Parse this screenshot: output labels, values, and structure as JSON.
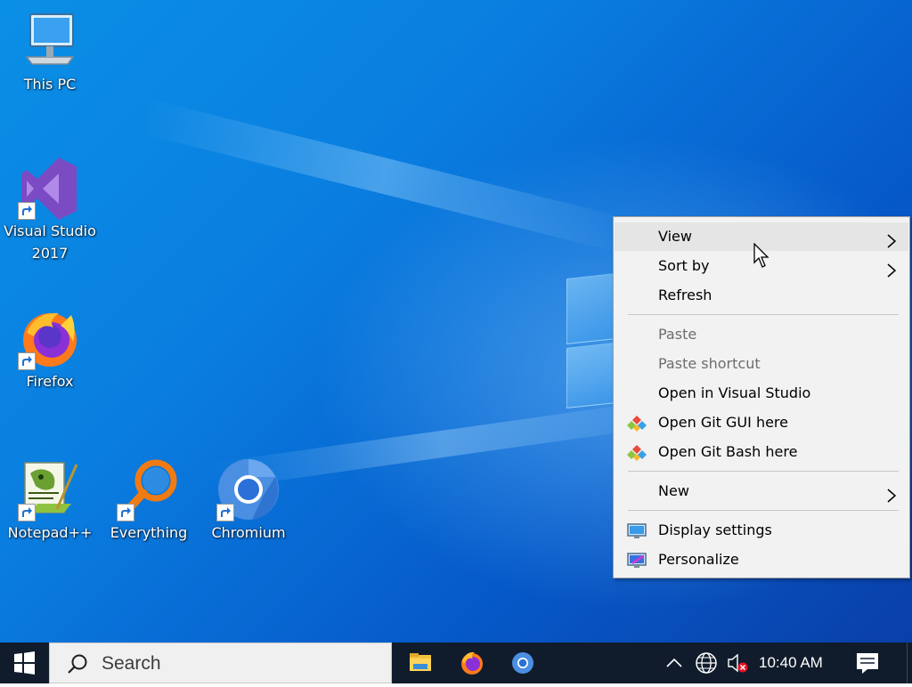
{
  "desktop": {
    "icons": [
      {
        "label": "This PC",
        "icon": "this-pc-icon"
      },
      {
        "label": "Visual Studio\n2017",
        "label_line1": "Visual Studio",
        "label_line2": "2017",
        "icon": "visual-studio-icon"
      },
      {
        "label": "Firefox",
        "icon": "firefox-icon"
      },
      {
        "label": "Notepad++",
        "icon": "notepad-plus-plus-icon"
      },
      {
        "label": "Everything",
        "icon": "everything-search-icon"
      },
      {
        "label": "Chromium",
        "icon": "chromium-icon"
      }
    ]
  },
  "context_menu": {
    "items": [
      {
        "label": "View",
        "submenu": true,
        "hover": true
      },
      {
        "label": "Sort by",
        "submenu": true
      },
      {
        "label": "Refresh"
      },
      {
        "label": "Paste",
        "disabled": true
      },
      {
        "label": "Paste shortcut",
        "disabled": true
      },
      {
        "label": "Open in Visual Studio"
      },
      {
        "label": "Open Git GUI here",
        "icon": "git-gui-icon"
      },
      {
        "label": "Open Git Bash here",
        "icon": "git-bash-icon"
      },
      {
        "label": "New",
        "submenu": true
      },
      {
        "label": "Display settings",
        "icon": "display-settings-icon"
      },
      {
        "label": "Personalize",
        "icon": "personalize-icon"
      }
    ]
  },
  "taskbar": {
    "search_placeholder": "Search",
    "pinned": [
      "file-explorer-icon",
      "firefox-icon",
      "chromium-icon"
    ],
    "tray": [
      "chevron-up-icon",
      "network-globe-icon",
      "volume-muted-icon"
    ],
    "clock": "10:40 AM",
    "notifications": "action-center-icon"
  },
  "colors": {
    "taskbar": "#101c2c",
    "menu_bg": "#f2f2f2",
    "menu_hover": "#e5e5e5",
    "disabled_text": "#6d6d6d",
    "wallpaper_accent": "#0a7ee0"
  }
}
